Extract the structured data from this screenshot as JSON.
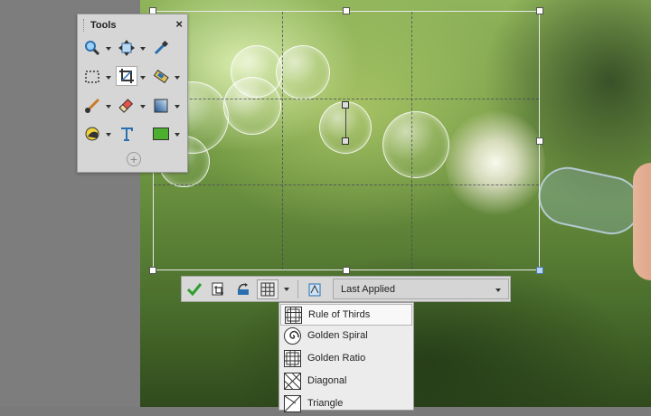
{
  "tools_panel": {
    "title": "Tools",
    "close_glyph": "×",
    "add_glyph": "+",
    "icons": [
      "zoom-icon",
      "pan-icon",
      "eyedropper-icon",
      "marquee-icon",
      "crop-icon",
      "straighten-icon",
      "paint-brush-icon",
      "eraser-icon",
      "gradient-icon",
      "burn-icon",
      "text-icon",
      "fill-color-icon"
    ],
    "fill_color": "#4caf2e"
  },
  "property_bar": {
    "buttons": [
      "apply-check-icon",
      "crop-to-selection-icon",
      "rotate-icon",
      "overlay-grid-icon",
      "overlay-options-icon"
    ],
    "preset": "Last Applied"
  },
  "overlay_menu": {
    "items": [
      {
        "label": "Rule of Thirds",
        "icon": "rule-of-thirds-icon"
      },
      {
        "label": "Golden Spiral",
        "icon": "golden-spiral-icon"
      },
      {
        "label": "Golden Ratio",
        "icon": "golden-ratio-icon"
      },
      {
        "label": "Diagonal",
        "icon": "diagonal-icon"
      },
      {
        "label": "Triangle",
        "icon": "triangle-icon"
      }
    ],
    "selected": "Rule of Thirds"
  },
  "colors": {
    "check_green": "#2f9e2f",
    "accent_blue": "#2a6fb0"
  }
}
